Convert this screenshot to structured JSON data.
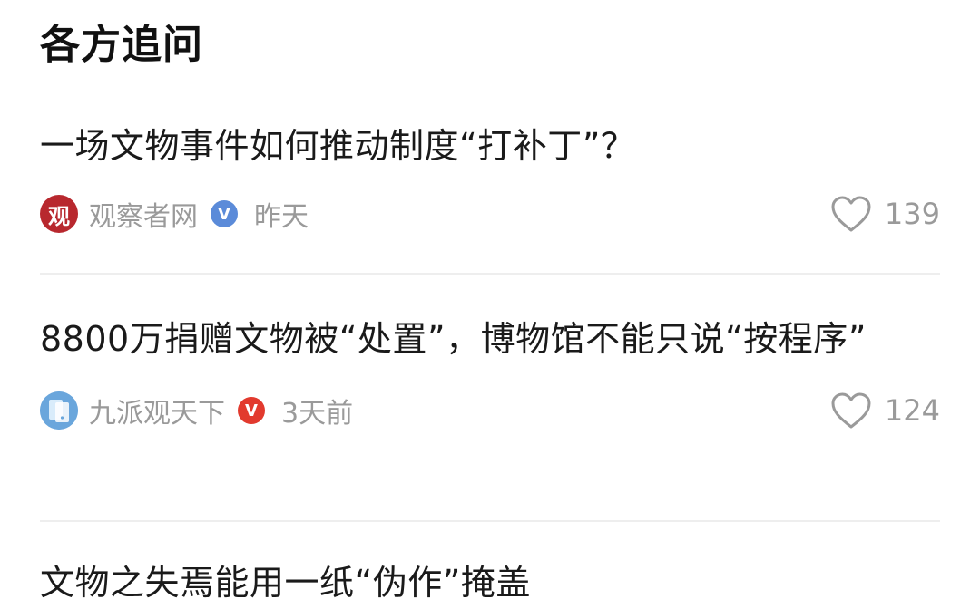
{
  "section": {
    "title": "各方追问"
  },
  "articles": [
    {
      "title": "一场文物事件如何推动制度“打补丁”？",
      "source": "观察者网",
      "avatar_text": "观",
      "verified_color": "#5b8bd9",
      "time": "昨天",
      "likes": "139"
    },
    {
      "title": "8800万捐赠文物被“处置”，博物馆不能只说“按程序”",
      "source": "九派观天下",
      "verified_color": "#e23a2e",
      "time": "3天前",
      "likes": "124"
    },
    {
      "title": "文物之失焉能用一纸“伪作”掩盖"
    }
  ],
  "icons": {
    "verified": "v-badge-icon",
    "like": "heart-icon"
  }
}
